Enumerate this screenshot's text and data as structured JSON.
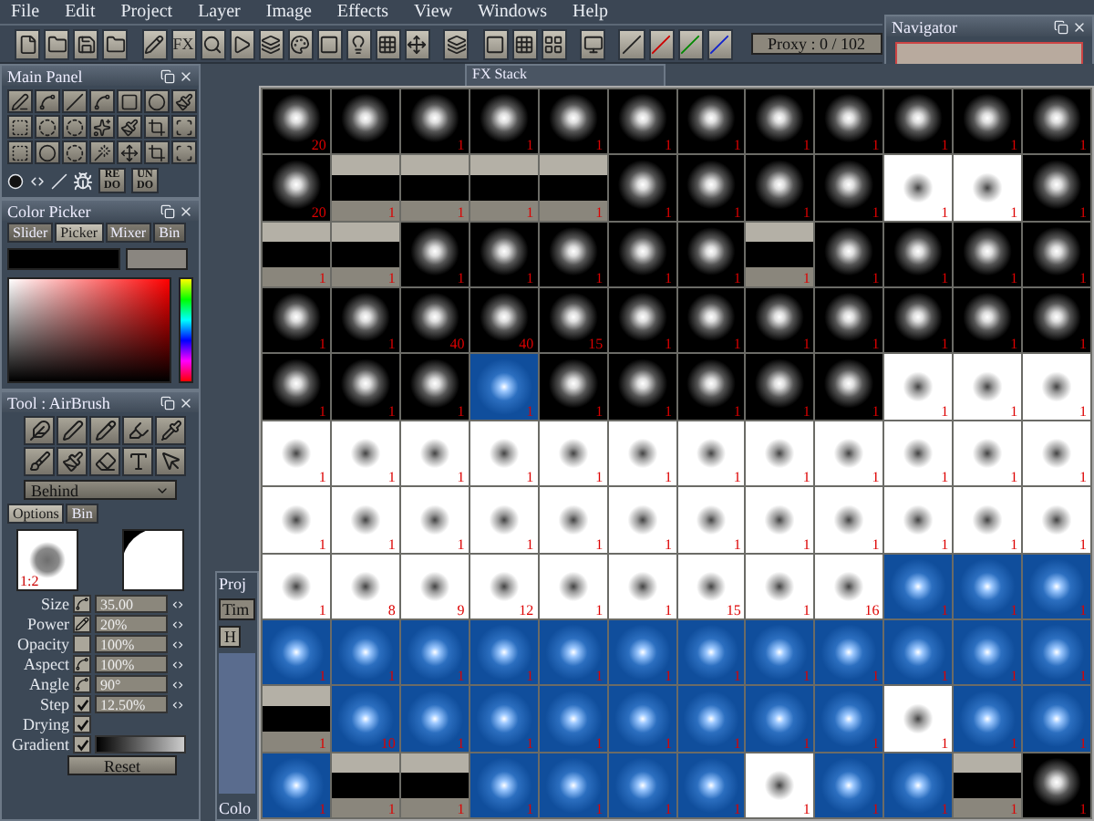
{
  "menu": [
    "File",
    "Edit",
    "Project",
    "Layer",
    "Image",
    "Effects",
    "View",
    "Windows",
    "Help"
  ],
  "toolbar": {
    "fx_label": "FX",
    "proxy": "Proxy : 0 / 102"
  },
  "navigator": {
    "title": "Navigator"
  },
  "main_panel": {
    "title": "Main Panel",
    "buttons": [
      "RE DO",
      "UN DO"
    ]
  },
  "color_picker": {
    "title": "Color Picker",
    "tabs": [
      {
        "label": "Slider",
        "selected": false
      },
      {
        "label": "Picker",
        "selected": true
      },
      {
        "label": "Mixer",
        "selected": false
      },
      {
        "label": "Bin",
        "selected": false
      }
    ]
  },
  "tool_panel": {
    "title": "Tool : AirBrush",
    "mode": "Behind",
    "tabs": [
      {
        "label": "Options",
        "selected": true
      },
      {
        "label": "Bin",
        "selected": false
      }
    ],
    "zoom_ratio": "1:2",
    "params": [
      {
        "label": "Size",
        "kind": "curve",
        "value": "35.00"
      },
      {
        "label": "Power",
        "kind": "fade",
        "value": "20%"
      },
      {
        "label": "Opacity",
        "kind": "none",
        "value": "100%"
      },
      {
        "label": "Aspect",
        "kind": "curve",
        "value": "100%"
      },
      {
        "label": "Angle",
        "kind": "curve",
        "value": "90°"
      },
      {
        "label": "Step",
        "kind": "check",
        "checked": true,
        "value": "12.50%"
      },
      {
        "label": "Drying",
        "kind": "check",
        "checked": true
      },
      {
        "label": "Gradient",
        "kind": "gradient",
        "checked": true
      }
    ],
    "reset": "Reset"
  },
  "fx_stack": {
    "title": "FX Stack"
  },
  "project_panel": {
    "title": "Proj",
    "tab": "Tim",
    "column": "H",
    "footer": "Colo"
  },
  "brush_grid": {
    "rows": [
      {
        "cells": [
          {
            "kind": "dark",
            "count": "20"
          },
          {
            "kind": "dark"
          },
          {
            "kind": "dark",
            "count": "1"
          },
          {
            "kind": "dark",
            "count": "1"
          },
          {
            "kind": "dark",
            "count": "1"
          },
          {
            "kind": "dark",
            "count": "1"
          },
          {
            "kind": "dark",
            "count": "1"
          },
          {
            "kind": "dark",
            "count": "1"
          },
          {
            "kind": "dark",
            "count": "1"
          },
          {
            "kind": "dark",
            "count": "1"
          },
          {
            "kind": "dark",
            "count": "1"
          },
          {
            "kind": "dark",
            "count": "1"
          }
        ]
      },
      {
        "cells": [
          {
            "kind": "dark",
            "count": "20"
          },
          {
            "kind": "grey",
            "count": "1"
          },
          {
            "kind": "grey",
            "count": "1"
          },
          {
            "kind": "grey",
            "count": "1"
          },
          {
            "kind": "grey",
            "count": "1"
          },
          {
            "kind": "dark",
            "count": "1"
          },
          {
            "kind": "dark",
            "count": "1"
          },
          {
            "kind": "dark",
            "count": "1"
          },
          {
            "kind": "dark",
            "count": "1"
          },
          {
            "kind": "light",
            "count": "1"
          },
          {
            "kind": "light",
            "count": "1"
          },
          {
            "kind": "dark",
            "count": "1"
          }
        ]
      },
      {
        "cells": [
          {
            "kind": "grey",
            "count": "1"
          },
          {
            "kind": "grey",
            "count": "1"
          },
          {
            "kind": "dark",
            "count": "1"
          },
          {
            "kind": "dark",
            "count": "1"
          },
          {
            "kind": "dark",
            "count": "1"
          },
          {
            "kind": "dark",
            "count": "1"
          },
          {
            "kind": "dark",
            "count": "1"
          },
          {
            "kind": "grey",
            "count": "1"
          },
          {
            "kind": "dark",
            "count": "1"
          },
          {
            "kind": "dark",
            "count": "1"
          },
          {
            "kind": "dark",
            "count": "1"
          },
          {
            "kind": "dark",
            "count": "1"
          }
        ]
      },
      {
        "cells": [
          {
            "kind": "dark",
            "count": "1"
          },
          {
            "kind": "dark",
            "count": "1"
          },
          {
            "kind": "dark",
            "count": "40"
          },
          {
            "kind": "dark",
            "count": "40"
          },
          {
            "kind": "dark",
            "count": "15"
          },
          {
            "kind": "dark",
            "count": "1"
          },
          {
            "kind": "dark",
            "count": "1"
          },
          {
            "kind": "dark",
            "count": "1"
          },
          {
            "kind": "dark",
            "count": "1"
          },
          {
            "kind": "dark",
            "count": "1"
          },
          {
            "kind": "dark",
            "count": "1"
          },
          {
            "kind": "dark",
            "count": "1"
          }
        ]
      },
      {
        "cells": [
          {
            "kind": "dark",
            "count": "1"
          },
          {
            "kind": "dark",
            "count": "1"
          },
          {
            "kind": "dark",
            "count": "1"
          },
          {
            "kind": "blue",
            "count": "1"
          },
          {
            "kind": "dark",
            "count": "1"
          },
          {
            "kind": "dark",
            "count": "1"
          },
          {
            "kind": "dark",
            "count": "1"
          },
          {
            "kind": "dark",
            "count": "1"
          },
          {
            "kind": "dark",
            "count": "1"
          },
          {
            "kind": "light",
            "count": "1"
          },
          {
            "kind": "light",
            "count": "1"
          },
          {
            "kind": "light",
            "count": "1"
          }
        ]
      },
      {
        "cells": [
          {
            "kind": "light",
            "count": "1"
          },
          {
            "kind": "light",
            "count": "1"
          },
          {
            "kind": "light",
            "count": "1"
          },
          {
            "kind": "light",
            "count": "1"
          },
          {
            "kind": "light",
            "count": "1"
          },
          {
            "kind": "light",
            "count": "1"
          },
          {
            "kind": "light",
            "count": "1"
          },
          {
            "kind": "light",
            "count": "1"
          },
          {
            "kind": "light",
            "count": "1"
          },
          {
            "kind": "light",
            "count": "1"
          },
          {
            "kind": "light",
            "count": "1"
          },
          {
            "kind": "light",
            "count": "1"
          }
        ]
      },
      {
        "cells": [
          {
            "kind": "light",
            "count": "1"
          },
          {
            "kind": "light",
            "count": "1"
          },
          {
            "kind": "light",
            "count": "1"
          },
          {
            "kind": "light",
            "count": "1"
          },
          {
            "kind": "light",
            "count": "1"
          },
          {
            "kind": "light",
            "count": "1"
          },
          {
            "kind": "light",
            "count": "1"
          },
          {
            "kind": "light",
            "count": "1"
          },
          {
            "kind": "light",
            "count": "1"
          },
          {
            "kind": "light",
            "count": "1"
          },
          {
            "kind": "light",
            "count": "1"
          },
          {
            "kind": "light",
            "count": "1"
          }
        ]
      },
      {
        "cells": [
          {
            "kind": "light",
            "count": "1"
          },
          {
            "kind": "light",
            "count": "8"
          },
          {
            "kind": "light",
            "count": "9"
          },
          {
            "kind": "light",
            "count": "12"
          },
          {
            "kind": "light",
            "count": "1"
          },
          {
            "kind": "light",
            "count": "1"
          },
          {
            "kind": "light",
            "count": "15"
          },
          {
            "kind": "light",
            "count": "1"
          },
          {
            "kind": "light",
            "count": "16"
          },
          {
            "kind": "blue",
            "count": "1"
          },
          {
            "kind": "blue",
            "count": "1"
          },
          {
            "kind": "blue",
            "count": "1"
          }
        ]
      },
      {
        "cells": [
          {
            "kind": "blue",
            "count": "1"
          },
          {
            "kind": "blue",
            "count": "1"
          },
          {
            "kind": "blue",
            "count": "1"
          },
          {
            "kind": "blue",
            "count": "1"
          },
          {
            "kind": "blue",
            "count": "1"
          },
          {
            "kind": "blue",
            "count": "1"
          },
          {
            "kind": "blue",
            "count": "1"
          },
          {
            "kind": "blue",
            "count": "1"
          },
          {
            "kind": "blue",
            "count": "1"
          },
          {
            "kind": "blue",
            "count": "1"
          },
          {
            "kind": "blue",
            "count": "1"
          },
          {
            "kind": "blue",
            "count": "1"
          }
        ]
      },
      {
        "cells": [
          {
            "kind": "grey",
            "count": "1"
          },
          {
            "kind": "blue",
            "count": "10"
          },
          {
            "kind": "blue",
            "count": "1"
          },
          {
            "kind": "blue",
            "count": "1"
          },
          {
            "kind": "blue",
            "count": "1"
          },
          {
            "kind": "blue",
            "count": "1"
          },
          {
            "kind": "blue",
            "count": "1"
          },
          {
            "kind": "blue",
            "count": "1"
          },
          {
            "kind": "blue",
            "count": "1"
          },
          {
            "kind": "light",
            "count": "1"
          },
          {
            "kind": "blue",
            "count": "1"
          },
          {
            "kind": "blue",
            "count": "1"
          }
        ]
      },
      {
        "cells": [
          {
            "kind": "blue",
            "count": "1"
          },
          {
            "kind": "grey",
            "count": "1"
          },
          {
            "kind": "grey",
            "count": "1"
          },
          {
            "kind": "blue",
            "count": "1"
          },
          {
            "kind": "blue",
            "count": "1"
          },
          {
            "kind": "blue",
            "count": "1"
          },
          {
            "kind": "blue",
            "count": "1"
          },
          {
            "kind": "light",
            "count": "1"
          },
          {
            "kind": "blue",
            "count": "1"
          },
          {
            "kind": "blue",
            "count": "1"
          },
          {
            "kind": "grey",
            "count": "1"
          },
          {
            "kind": "dark",
            "count": "1"
          }
        ]
      }
    ]
  }
}
